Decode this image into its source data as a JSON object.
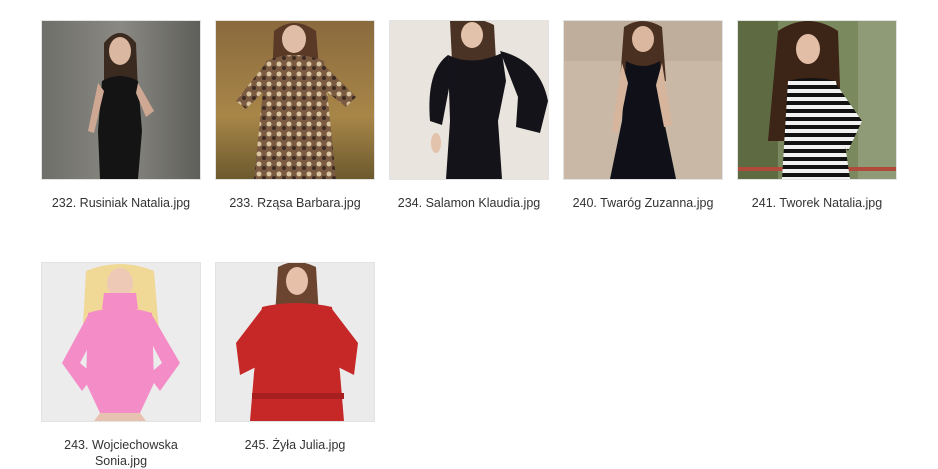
{
  "gallery": {
    "items": [
      {
        "caption": "232. Rusiniak Natalia.jpg"
      },
      {
        "caption": "233. Rząsa Barbara.jpg"
      },
      {
        "caption": "234. Salamon Klaudia.jpg"
      },
      {
        "caption": "240. Twaróg Zuzanna.jpg"
      },
      {
        "caption": "241. Tworek Natalia.jpg"
      },
      {
        "caption": "243. Wojciechowska Sonia.jpg"
      },
      {
        "caption": "245. Żyła Julia.jpg"
      }
    ]
  }
}
